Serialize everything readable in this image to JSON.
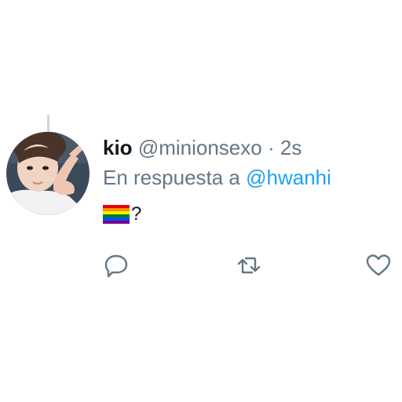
{
  "tweet": {
    "display_name": "kio",
    "handle": "@minionsexo",
    "separator": "·",
    "time": "2s",
    "reply_prefix": "En respuesta a",
    "reply_to": "@hwanhi",
    "body_emoji": "rainbow-flag-icon",
    "body_text": "?"
  },
  "actions": [
    "reply-icon",
    "retweet-icon",
    "like-icon"
  ],
  "colors": {
    "name": "#14171a",
    "meta": "#657786",
    "link": "#1da1f2",
    "icon": "#657786",
    "thread_line": "#cfd6dc"
  }
}
